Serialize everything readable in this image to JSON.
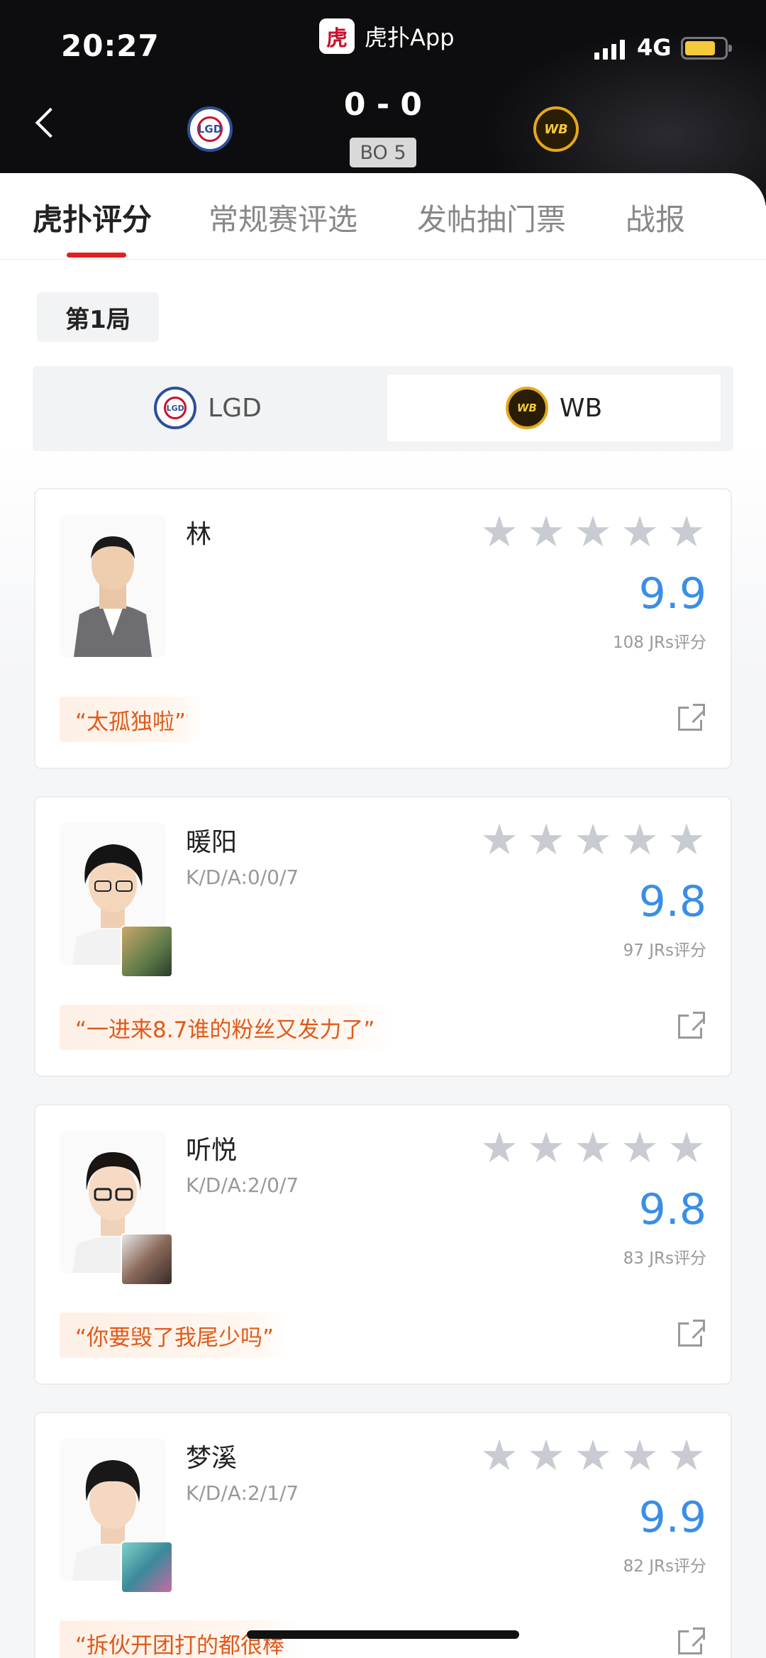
{
  "status_bar": {
    "time": "20:27",
    "app_name": "虎扑App",
    "network": "4G"
  },
  "match": {
    "score": "0 - 0",
    "format": "BO 5",
    "left_team": "LGD",
    "right_team": "WB"
  },
  "tabs": [
    {
      "label": "虎扑评分",
      "active": true
    },
    {
      "label": "常规赛评选",
      "active": false
    },
    {
      "label": "发帖抽门票",
      "active": false
    },
    {
      "label": "战报",
      "active": false
    }
  ],
  "round_label": "第1局",
  "team_switch": [
    {
      "label": "LGD",
      "selected": false
    },
    {
      "label": "WB",
      "selected": true
    }
  ],
  "players": [
    {
      "name": "林",
      "kda": "",
      "rating": "9.9",
      "votes": "108 JRs评分",
      "quote": "“太孤独啦”",
      "stars": 5
    },
    {
      "name": "暖阳",
      "kda": "K/D/A:0/0/7",
      "rating": "9.8",
      "votes": "97 JRs评分",
      "quote": "“一进来8.7谁的粉丝又发力了”",
      "stars": 5
    },
    {
      "name": "听悦",
      "kda": "K/D/A:2/0/7",
      "rating": "9.8",
      "votes": "83 JRs评分",
      "quote": "“你要毁了我尾少吗”",
      "stars": 5
    },
    {
      "name": "梦溪",
      "kda": "K/D/A:2/1/7",
      "rating": "9.9",
      "votes": "82 JRs评分",
      "quote": "“拆伙开团打的都很棒",
      "stars": 5
    }
  ],
  "colors": {
    "accent_red": "#e02020",
    "rating_blue": "#3a8ee6",
    "quote_orange": "#e05a1a"
  }
}
